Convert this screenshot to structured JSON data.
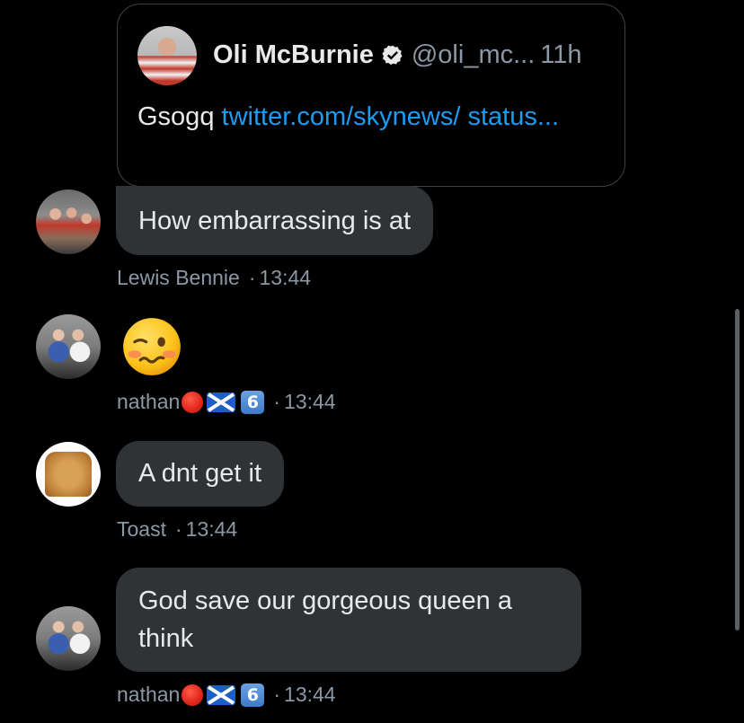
{
  "quote": {
    "name": "Oli McBurnie",
    "handle": "@oli_mc...",
    "time": "11h",
    "text": "Gsogq",
    "link": "twitter.com/skynews/ status..."
  },
  "messages": [
    {
      "text": "How embarrassing is at",
      "sender": "Lewis Bennie",
      "time": "13:44"
    },
    {
      "emoji": "woozy-face",
      "sender": "nathan",
      "badges": [
        "red-circle",
        "scotland-flag",
        "keycap-6"
      ],
      "keycap_text": "6",
      "time": "13:44"
    },
    {
      "text": "A dnt get it",
      "sender": "Toast",
      "time": "13:44"
    },
    {
      "text": "God save our gorgeous queen a think",
      "sender": "nathan",
      "badges": [
        "red-circle",
        "scotland-flag",
        "keycap-6"
      ],
      "keycap_text": "6",
      "time": "13:44"
    }
  ],
  "separator": "·",
  "colors": {
    "background": "#000000",
    "bubble": "#2f3336",
    "link": "#1d9bf0",
    "meta_text": "#8b98a5",
    "card_border": "#3d4247"
  }
}
